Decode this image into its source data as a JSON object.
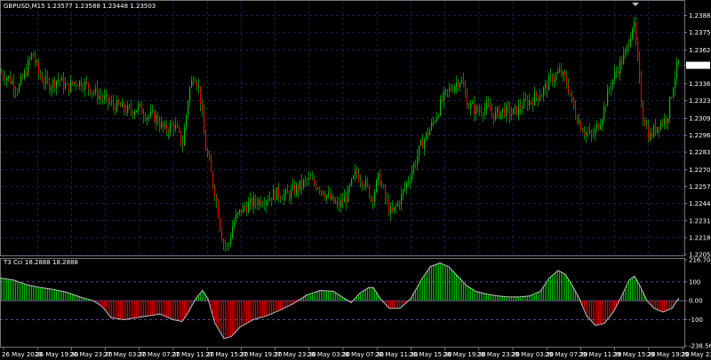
{
  "header": {
    "main_title": "GBPUSD,M15  1.23577 1.23588 1.23448 1.23503",
    "indicator_title": "T3 Cci 18.2888 18.2888"
  },
  "colors": {
    "background": "#000000",
    "grid": "#2a2f7a",
    "bull": "#00c000",
    "bear": "#e00000",
    "wick": "#00c000",
    "osc_line": "#c0c0c0",
    "level_line": "#7a5ab5"
  },
  "price_axis": {
    "labels": [
      "1.23885",
      "1.23755",
      "1.23620",
      "1.23503",
      "1.23360",
      "1.23230",
      "1.23095",
      "1.22965",
      "1.22835",
      "1.22700",
      "1.22570",
      "1.22440",
      "1.22310",
      "1.22180",
      "1.22050"
    ],
    "current_price": "1.23503"
  },
  "osc_axis": {
    "labels": [
      "216.7043",
      "100",
      "0.00",
      "-100",
      "-238.56"
    ]
  },
  "time_axis": {
    "labels": [
      "26 May 2020",
      "26 May 19:30",
      "26 May 23:30",
      "27 May 03:30",
      "27 May 07:30",
      "27 May 11:30",
      "27 May 15:30",
      "27 May 19:30",
      "27 May 23:30",
      "28 May 03:30",
      "28 May 07:30",
      "28 May 11:30",
      "28 May 15:30",
      "28 May 19:30",
      "28 May 23:30",
      "29 May 03:30",
      "29 May 07:30",
      "29 May 11:30",
      "29 May 15:30",
      "29 May 19:30",
      "29 May 23:30"
    ]
  },
  "chart_data": [
    {
      "type": "candlestick",
      "symbol": "GBPUSD",
      "timeframe": "M15",
      "title": "GBPUSD,M15  1.23577 1.23588 1.23448 1.23503",
      "ylim": [
        1.2205,
        1.2395
      ],
      "close_path": [
        [
          0,
          1.2345
        ],
        [
          10,
          1.234
        ],
        [
          20,
          1.2332
        ],
        [
          28,
          1.2345
        ],
        [
          36,
          1.236
        ],
        [
          44,
          1.2342
        ],
        [
          55,
          1.2335
        ],
        [
          65,
          1.234
        ],
        [
          75,
          1.2333
        ],
        [
          85,
          1.2338
        ],
        [
          95,
          1.2336
        ],
        [
          105,
          1.233
        ],
        [
          115,
          1.2325
        ],
        [
          125,
          1.232
        ],
        [
          135,
          1.2318
        ],
        [
          145,
          1.2315
        ],
        [
          155,
          1.2318
        ],
        [
          165,
          1.2312
        ],
        [
          175,
          1.231
        ],
        [
          185,
          1.23
        ],
        [
          195,
          1.2305
        ],
        [
          205,
          1.229
        ],
        [
          212,
          1.233
        ],
        [
          218,
          1.2345
        ],
        [
          224,
          1.233
        ],
        [
          230,
          1.229
        ],
        [
          236,
          1.227
        ],
        [
          242,
          1.225
        ],
        [
          250,
          1.2215
        ],
        [
          256,
          1.221
        ],
        [
          262,
          1.223
        ],
        [
          272,
          1.224
        ],
        [
          285,
          1.2245
        ],
        [
          298,
          1.2248
        ],
        [
          310,
          1.2252
        ],
        [
          322,
          1.225
        ],
        [
          334,
          1.2256
        ],
        [
          346,
          1.2262
        ],
        [
          358,
          1.2258
        ],
        [
          370,
          1.2248
        ],
        [
          380,
          1.2242
        ],
        [
          390,
          1.225
        ],
        [
          400,
          1.2268
        ],
        [
          410,
          1.226
        ],
        [
          418,
          1.2248
        ],
        [
          426,
          1.2265
        ],
        [
          432,
          1.225
        ],
        [
          440,
          1.2235
        ],
        [
          450,
          1.2248
        ],
        [
          462,
          1.2268
        ],
        [
          474,
          1.229
        ],
        [
          486,
          1.2305
        ],
        [
          498,
          1.2325
        ],
        [
          510,
          1.2335
        ],
        [
          518,
          1.234
        ],
        [
          526,
          1.232
        ],
        [
          536,
          1.2315
        ],
        [
          546,
          1.2318
        ],
        [
          556,
          1.2312
        ],
        [
          566,
          1.2316
        ],
        [
          576,
          1.2313
        ],
        [
          588,
          1.232
        ],
        [
          600,
          1.2325
        ],
        [
          610,
          1.233
        ],
        [
          620,
          1.234
        ],
        [
          630,
          1.2345
        ],
        [
          638,
          1.2335
        ],
        [
          646,
          1.2315
        ],
        [
          656,
          1.23
        ],
        [
          666,
          1.2295
        ],
        [
          676,
          1.231
        ],
        [
          686,
          1.2335
        ],
        [
          696,
          1.235
        ],
        [
          704,
          1.236
        ],
        [
          712,
          1.2385
        ],
        [
          716,
          1.236
        ],
        [
          722,
          1.2315
        ],
        [
          730,
          1.2295
        ],
        [
          740,
          1.2305
        ],
        [
          750,
          1.231
        ],
        [
          758,
          1.234
        ],
        [
          764,
          1.2355
        ]
      ]
    },
    {
      "type": "histogram",
      "name": "T3 Cci",
      "title": "T3 Cci 18.2888 18.2888",
      "value": 18.2888,
      "ylim": [
        -238.56,
        216.7043
      ],
      "levels": [
        100,
        0,
        -100
      ],
      "line_path": [
        [
          0,
          120
        ],
        [
          15,
          110
        ],
        [
          30,
          85
        ],
        [
          45,
          70
        ],
        [
          60,
          60
        ],
        [
          75,
          45
        ],
        [
          90,
          20
        ],
        [
          105,
          0
        ],
        [
          115,
          -30
        ],
        [
          125,
          -90
        ],
        [
          140,
          -100
        ],
        [
          160,
          -85
        ],
        [
          180,
          -70
        ],
        [
          195,
          -100
        ],
        [
          205,
          -110
        ],
        [
          212,
          -60
        ],
        [
          220,
          10
        ],
        [
          228,
          55
        ],
        [
          234,
          10
        ],
        [
          242,
          -120
        ],
        [
          252,
          -200
        ],
        [
          260,
          -190
        ],
        [
          270,
          -140
        ],
        [
          285,
          -100
        ],
        [
          300,
          -80
        ],
        [
          315,
          -50
        ],
        [
          330,
          -15
        ],
        [
          345,
          30
        ],
        [
          360,
          55
        ],
        [
          375,
          50
        ],
        [
          385,
          20
        ],
        [
          395,
          -10
        ],
        [
          405,
          40
        ],
        [
          415,
          70
        ],
        [
          420,
          70
        ],
        [
          428,
          10
        ],
        [
          438,
          -40
        ],
        [
          450,
          -40
        ],
        [
          462,
          10
        ],
        [
          474,
          110
        ],
        [
          484,
          180
        ],
        [
          495,
          200
        ],
        [
          505,
          180
        ],
        [
          515,
          130
        ],
        [
          525,
          80
        ],
        [
          535,
          50
        ],
        [
          548,
          35
        ],
        [
          560,
          25
        ],
        [
          572,
          20
        ],
        [
          584,
          20
        ],
        [
          596,
          25
        ],
        [
          608,
          50
        ],
        [
          618,
          120
        ],
        [
          628,
          160
        ],
        [
          636,
          140
        ],
        [
          644,
          80
        ],
        [
          652,
          10
        ],
        [
          660,
          -80
        ],
        [
          670,
          -130
        ],
        [
          680,
          -120
        ],
        [
          690,
          -60
        ],
        [
          700,
          30
        ],
        [
          708,
          110
        ],
        [
          714,
          130
        ],
        [
          720,
          80
        ],
        [
          728,
          0
        ],
        [
          736,
          -40
        ],
        [
          746,
          -60
        ],
        [
          756,
          -40
        ],
        [
          764,
          15
        ]
      ]
    }
  ]
}
